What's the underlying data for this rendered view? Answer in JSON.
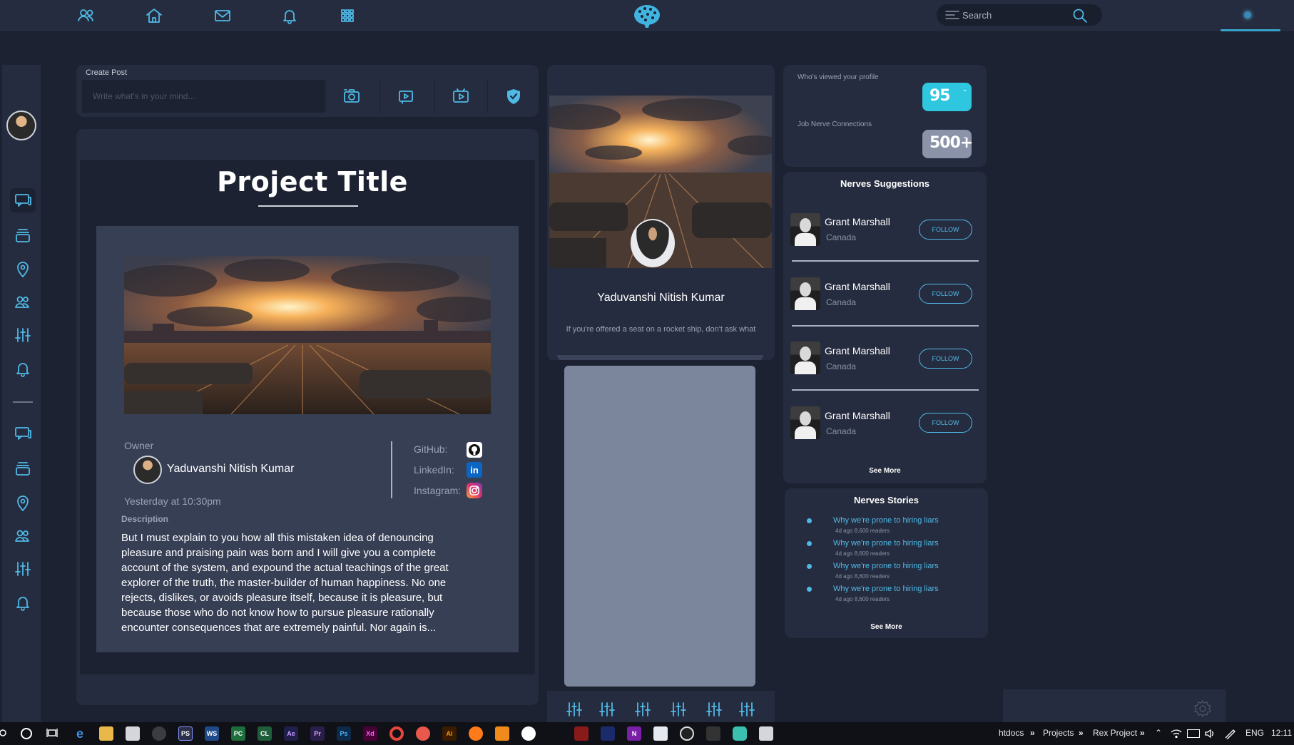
{
  "topbar": {
    "search_placeholder": "Search",
    "icons": [
      "people-icon",
      "home-icon",
      "mail-icon",
      "bell-icon",
      "grid-icon"
    ]
  },
  "create_post": {
    "label": "Create Post",
    "placeholder": "Write what's in your mind..."
  },
  "project": {
    "title": "Project Title",
    "owner_label": "Owner",
    "owner_name": "Yaduvanshi Nitish Kumar",
    "time": "Yesterday at 10:30pm",
    "socials": [
      {
        "label": "GitHub:"
      },
      {
        "label": "LinkedIn:",
        "glyph": "in"
      },
      {
        "label": "Instagram:"
      }
    ],
    "description_label": "Description",
    "description": "But I must explain to you how all this mistaken idea of denouncing pleasure and praising pain was born and I will give you a complete account of the system, and expound the actual teachings of the great explorer of the truth, the master-builder of human happiness. No one rejects, dislikes, or avoids pleasure itself, because it is pleasure, but because those who do not know how to pursue pleasure rationally encounter consequences that are extremely painful. Nor again is..."
  },
  "profile": {
    "name": "Yaduvanshi Nitish Kumar",
    "quote": "If you're offered a seat on a rocket ship, don't ask what"
  },
  "stats": [
    {
      "label": "Who's viewed your profile",
      "value": "95",
      "color": "#2fc6e0"
    },
    {
      "label": "Job Nerve Connections",
      "value": "500+",
      "color": "#8a93a8"
    }
  ],
  "suggestions": {
    "title": "Nerves Suggestions",
    "items": [
      {
        "name": "Grant Marshall",
        "location": "Canada",
        "button": "FOLLOW"
      },
      {
        "name": "Grant Marshall",
        "location": "Canada",
        "button": "FOLLOW"
      },
      {
        "name": "Grant Marshall",
        "location": "Canada",
        "button": "FOLLOW"
      },
      {
        "name": "Grant Marshall",
        "location": "Canada",
        "button": "FOLLOW"
      }
    ],
    "see_more": "See More"
  },
  "stories": {
    "title": "Nerves Stories",
    "items": [
      {
        "title": "Why we're prone to hiring liars",
        "meta": "4d ago    8,600 readers"
      },
      {
        "title": "Why we're prone to hiring liars",
        "meta": "4d ago    8,600 readers"
      },
      {
        "title": "Why we're prone to hiring liars",
        "meta": "4d ago    8,600 readers"
      },
      {
        "title": "Why we're prone to hiring liars",
        "meta": "4d ago    8,600 readers"
      }
    ],
    "see_more": "See More"
  },
  "taskbar": {
    "apps": [
      "PS",
      "WS",
      "PC",
      "CL",
      "Ae",
      "Pr",
      "Ps",
      "Xd",
      "Ai",
      "N"
    ],
    "breadcrumbs": [
      "htdocs",
      "Projects",
      "Rex Project"
    ],
    "lang": "ENG",
    "time": "12:11"
  },
  "colors": {
    "accent": "#4fb9e6",
    "background": "#1d2232",
    "panel": "#262c3f"
  }
}
